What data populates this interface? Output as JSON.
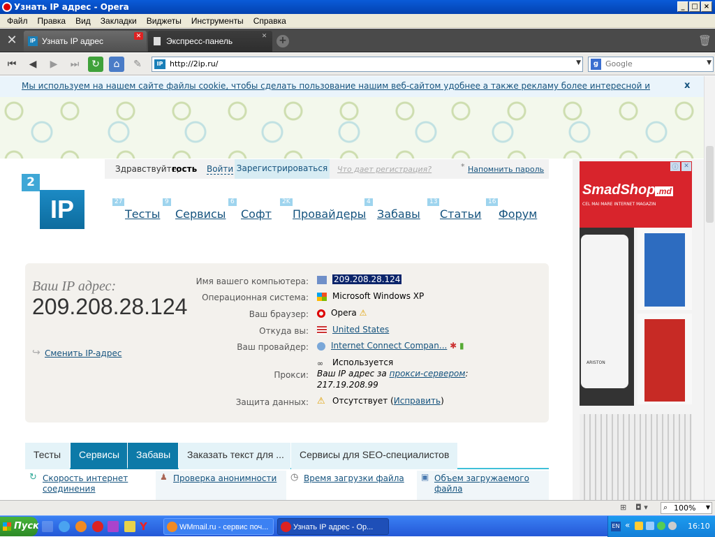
{
  "window": {
    "title": "Узнать IP адрес - Opera",
    "controls": [
      "_",
      "□",
      "×"
    ]
  },
  "menu": [
    "Файл",
    "Правка",
    "Вид",
    "Закладки",
    "Виджеты",
    "Инструменты",
    "Справка"
  ],
  "tabs": [
    {
      "label": "Узнать IP адрес",
      "active": true
    },
    {
      "label": "Экспресс-панель",
      "active": false
    }
  ],
  "address": {
    "url": "http://2ip.ru/",
    "search_placeholder": "Google"
  },
  "page": {
    "cookie_notice": "Мы используем на нашем сайте файлы cookie, чтобы сделать пользование нашим веб-сайтом удобнее а также рекламу более интересной и подходящей для вас.",
    "cookie_close": "x",
    "login": {
      "greeting": "Здравствуйте,",
      "guest": "гость",
      "dot": ".",
      "login_link": "Войти",
      "register": "Зарегистрироваться",
      "what_register": "Что дает регистрация?",
      "asterisk": "*",
      "remind": "Напомнить пароль"
    },
    "logo": {
      "small": "2",
      "big": "IP"
    },
    "nav": [
      {
        "count": "27",
        "label": "Тесты"
      },
      {
        "count": "9",
        "label": "Сервисы"
      },
      {
        "count": "6",
        "label": "Софт"
      },
      {
        "count": "2K",
        "label": "Провайдеры"
      },
      {
        "count": "4",
        "label": "Забавы"
      },
      {
        "count": "13",
        "label": "Статьи"
      },
      {
        "count": "16",
        "label": "Форум"
      }
    ],
    "ip": {
      "label": "Ваш IP адрес:",
      "value": "209.208.28.124",
      "change": "Сменить IP-адрес"
    },
    "info": [
      {
        "label": "Имя вашего компьютера:",
        "value": "209.208.28.124"
      },
      {
        "label": "Операционная система:",
        "value": "Microsoft Windows XP"
      },
      {
        "label": "Ваш браузер:",
        "value": "Opera"
      },
      {
        "label": "Откуда вы:",
        "value": "United States"
      },
      {
        "label": "Ваш провайдер:",
        "value": "Internet Connect Compan..."
      },
      {
        "label": "",
        "value": "Используется"
      },
      {
        "label": "Прокси:",
        "value_pre": "Ваш IP адрес за",
        "value_link": "прокси-сервером",
        "value_post": ":",
        "value_ip": "217.19.208.99"
      },
      {
        "label": "Защита данных:",
        "value_pre": "Отсутствует (",
        "value_link": "Исправить",
        "value_post": ")"
      }
    ],
    "bottom_tabs": [
      "Тесты",
      "Сервисы",
      "Забавы",
      "Заказать текст для ...",
      "Сервисы для SEO-специалистов"
    ],
    "services": [
      {
        "line1": "Скорость интернет",
        "line2": "соединения"
      },
      {
        "line1": "Проверка анонимности",
        "line2": ""
      },
      {
        "line1": "Время загрузки файла",
        "line2": ""
      },
      {
        "line1": "Объем загружаемого",
        "line2": "файла"
      }
    ],
    "ad": {
      "brand": "SmadShop",
      "brand_suffix": ".md",
      "tagline": "CEL MAI MARE INTERNET MAGAZIN",
      "product_brand": "ARISTON"
    }
  },
  "status": {
    "zoom": "100%"
  },
  "taskbar": {
    "start": "Пуск",
    "tasks": [
      {
        "label": "WMmail.ru - сервис поч...",
        "active": false
      },
      {
        "label": "Узнать IP адрес - Op...",
        "active": true
      }
    ],
    "lang": "EN",
    "clock": "16:10"
  },
  "colors": {
    "accent": "#0d7aa8",
    "link": "#15537e",
    "tab_active": "#0d7aa8"
  }
}
